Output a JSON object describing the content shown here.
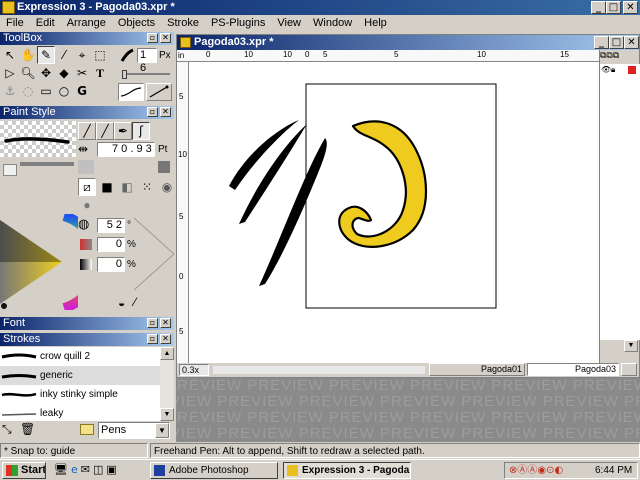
{
  "window": {
    "title": "Expression 3 - Pagoda03.xpr *",
    "min": "_",
    "max": "□",
    "close": "✕"
  },
  "menu": [
    "File",
    "Edit",
    "Arrange",
    "Objects",
    "Stroke",
    "PS-Plugins",
    "View",
    "Window",
    "Help"
  ],
  "toolbox": {
    "title": "ToolBox",
    "size_value": "1 6",
    "size_unit": "Px"
  },
  "paint_style": {
    "title": "Paint Style",
    "width_value": "7 0 . 9 3",
    "width_unit": "Pt",
    "hue_value": "5 2",
    "hue_unit": "°",
    "sat_value": "0",
    "sat_unit": "%",
    "lum_value": "0",
    "lum_unit": "%"
  },
  "font_panel": {
    "title": "Font"
  },
  "strokes_panel": {
    "title": "Strokes",
    "items": [
      "crow quill 2",
      "generic",
      "inky stinky simple",
      "leaky"
    ],
    "category": "Pens"
  },
  "document": {
    "title": "Pagoda03.xpr *",
    "ruler_unit": "in",
    "ruler_top": [
      "0",
      "10",
      "10",
      "5",
      "0",
      "5",
      "10",
      "15"
    ],
    "ruler_left": [
      "5",
      "10",
      "5",
      "0",
      "5"
    ],
    "zoom": "0.3x",
    "pages": [
      "Pagoda01",
      "Pagoda03"
    ]
  },
  "preview_watermark": "PREVIEW",
  "status": {
    "left": "* Snap to: guide",
    "right": "Freehand Pen: Alt to append, Shift to redraw a selected path."
  },
  "taskbar": {
    "start": "Start",
    "tasks": [
      "Adobe Photoshop",
      "Expression 3 - Pagoda..."
    ],
    "clock": "6:44 PM"
  },
  "colors": {
    "yellow_fill": "#eecb1e",
    "title_blue": "#0a246a"
  }
}
